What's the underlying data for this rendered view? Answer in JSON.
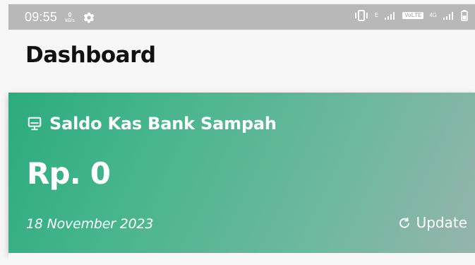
{
  "status_bar": {
    "time": "09:55",
    "data_speed_value": "0",
    "data_speed_unit": "kB/s",
    "sim1_label": "E",
    "volte_label": "VoLTE",
    "network_label": "4G"
  },
  "header": {
    "title": "Dashboard"
  },
  "balance_card": {
    "title": "Saldo Kas Bank Sampah",
    "amount": "Rp. 0",
    "date": "18 November 2023",
    "update_label": "Update",
    "icon": "monitor-icon"
  },
  "colors": {
    "status_bar": "#b8b8b8",
    "page_background": "#f7f7f7",
    "card_gradient_start": "#2cab7f",
    "card_gradient_end": "#96b4ab",
    "text_primary": "#111111",
    "text_on_card": "#ffffff"
  }
}
